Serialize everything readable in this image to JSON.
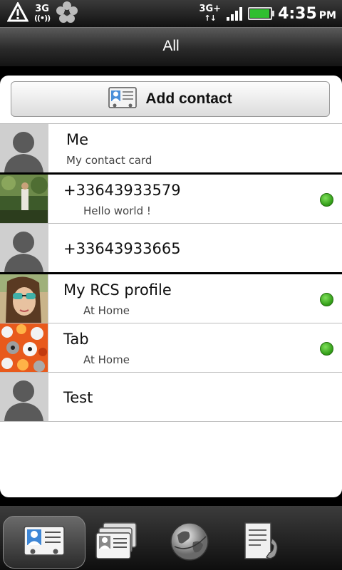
{
  "status_bar": {
    "network_top": "3G",
    "network_right_top": "3G+",
    "time": "4:35",
    "ampm": "PM",
    "battery_level": 0.9
  },
  "title_bar": {
    "title": "All"
  },
  "add_contact": {
    "label": "Add contact"
  },
  "contacts": [
    {
      "name": "Me",
      "status": "My contact card",
      "avatar": "silhouette",
      "online": false
    },
    {
      "name": "+33643933579",
      "status": "Hello world !",
      "avatar": "photo-outdoor",
      "online": true
    },
    {
      "name": "+33643933665",
      "status": "",
      "avatar": "silhouette",
      "online": false
    },
    {
      "name": "My RCS profile",
      "status": "At Home",
      "avatar": "photo-person",
      "online": true
    },
    {
      "name": "Tab",
      "status": "At Home",
      "avatar": "photo-pattern",
      "online": true
    },
    {
      "name": "Test",
      "status": "",
      "avatar": "silhouette",
      "online": false
    }
  ],
  "tabs": [
    {
      "icon": "contact-card-icon",
      "active": true
    },
    {
      "icon": "contact-groups-icon",
      "active": false
    },
    {
      "icon": "globe-icon",
      "active": false
    },
    {
      "icon": "call-history-icon",
      "active": false
    }
  ],
  "colors": {
    "presence_online": "#3cb81f"
  }
}
